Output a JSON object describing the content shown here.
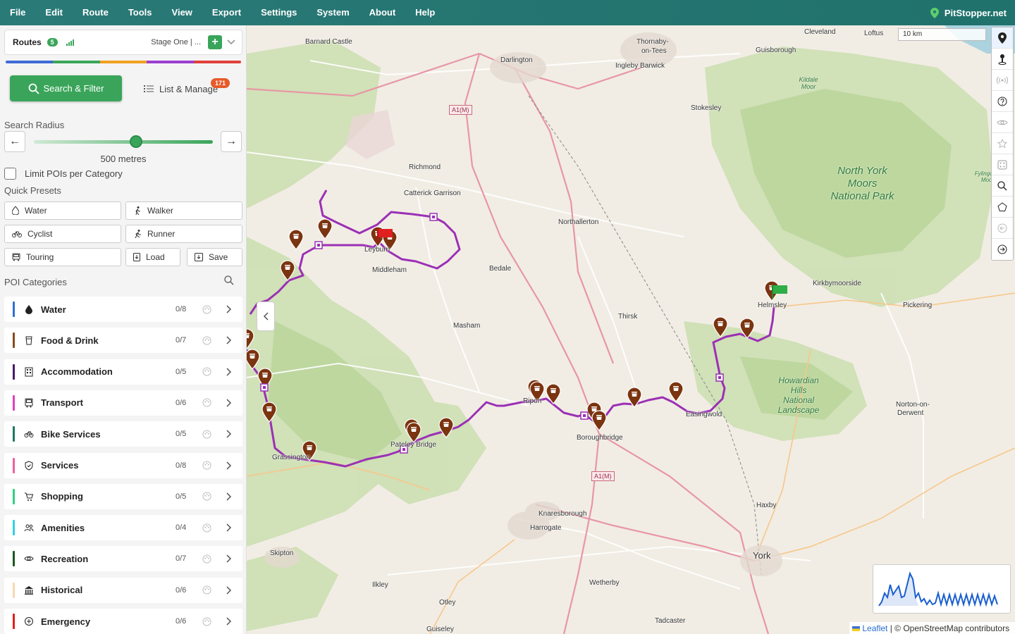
{
  "menu": [
    "File",
    "Edit",
    "Route",
    "Tools",
    "View",
    "Export",
    "Settings",
    "System",
    "About",
    "Help"
  ],
  "brand": "PitStopper.net",
  "routes": {
    "label": "Routes",
    "count": "5",
    "stage": "Stage One | ..."
  },
  "route_colors": [
    "#3f6bd6",
    "#3aa55a",
    "#f0a020",
    "#9b3fd0",
    "#e0403a"
  ],
  "buttons": {
    "search_filter": "Search & Filter",
    "list_manage": "List & Manage",
    "list_badge": "171"
  },
  "search_radius": {
    "label": "Search Radius",
    "value_text": "500 metres",
    "fraction": 0.57
  },
  "limit_pois": "Limit POIs per Category",
  "quick_presets": {
    "label": "Quick Presets",
    "items": [
      "Water",
      "Walker",
      "Cyclist",
      "Runner",
      "Touring",
      "Load",
      "Save"
    ]
  },
  "poi_categories": {
    "label": "POI Categories",
    "items": [
      {
        "name": "Water",
        "count": "0/8",
        "color": "#2f6fd0",
        "icon": "water-drop-icon"
      },
      {
        "name": "Food & Drink",
        "count": "0/7",
        "color": "#8b4a1c",
        "icon": "cup-icon"
      },
      {
        "name": "Accommodation",
        "count": "0/5",
        "color": "#4a1a6a",
        "icon": "building-icon"
      },
      {
        "name": "Transport",
        "count": "0/6",
        "color": "#e040c0",
        "icon": "bus-icon"
      },
      {
        "name": "Bike Services",
        "count": "0/5",
        "color": "#1a7a60",
        "icon": "bike-icon"
      },
      {
        "name": "Services",
        "count": "0/8",
        "color": "#f060a0",
        "icon": "shield-icon"
      },
      {
        "name": "Shopping",
        "count": "0/5",
        "color": "#30d080",
        "icon": "cart-icon"
      },
      {
        "name": "Amenities",
        "count": "0/4",
        "color": "#30d0e0",
        "icon": "people-icon"
      },
      {
        "name": "Recreation",
        "count": "0/7",
        "color": "#1a5a20",
        "icon": "eye-icon"
      },
      {
        "name": "Historical",
        "count": "0/6",
        "color": "#f8d8b0",
        "icon": "museum-icon"
      },
      {
        "name": "Emergency",
        "count": "0/6",
        "color": "#e02020",
        "icon": "plus-circle-icon"
      }
    ]
  },
  "map": {
    "scale": "10 km",
    "towns": [
      {
        "name": "Barnard Castle"
      },
      {
        "name": "Darlington"
      },
      {
        "name": "Thornaby-"
      },
      {
        "name": "on-Tees"
      },
      {
        "name": "Ingleby Barwick"
      },
      {
        "name": "Cleveland"
      },
      {
        "name": "Loftus"
      },
      {
        "name": "Guisborough"
      },
      {
        "name": "Stokesley"
      },
      {
        "name": "Richmond"
      },
      {
        "name": "Catterick Garrison"
      },
      {
        "name": "Northallerton"
      },
      {
        "name": "Leyburn"
      },
      {
        "name": "Middleham"
      },
      {
        "name": "Bedale"
      },
      {
        "name": "Masham"
      },
      {
        "name": "Thirsk"
      },
      {
        "name": "Helmsley"
      },
      {
        "name": "Kirkbymoorside"
      },
      {
        "name": "Pickering"
      },
      {
        "name": "Ripon"
      },
      {
        "name": "Boroughbridge"
      },
      {
        "name": "Easingwold"
      },
      {
        "name": "Pateley Bridge"
      },
      {
        "name": "Grassington"
      },
      {
        "name": "Norton-on-"
      },
      {
        "name": "Derwent"
      },
      {
        "name": "Knaresborough"
      },
      {
        "name": "Harrogate"
      },
      {
        "name": "Haxby"
      },
      {
        "name": "York"
      },
      {
        "name": "Skipton"
      },
      {
        "name": "Ilkley"
      },
      {
        "name": "Wetherby"
      },
      {
        "name": "Otley"
      },
      {
        "name": "Tadcaster"
      },
      {
        "name": "Guiseley"
      }
    ],
    "parks": [
      "North York Moors National Park",
      "Howardian Hills National Landscape",
      "Kildale Moor",
      "Fylingdale Moor"
    ],
    "roads": [
      "A1(M)",
      "A1(M)"
    ],
    "attribution_leaflet": "Leaflet",
    "attribution_rest": "| © OpenStreetMap contributors"
  },
  "route_color": "#9b30b5"
}
